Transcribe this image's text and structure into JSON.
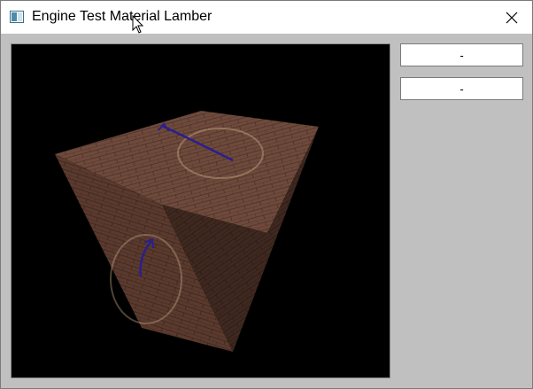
{
  "window": {
    "title": "Engine Test Material Lamber",
    "close_glyph": "✕"
  },
  "sidebar": {
    "buttons": [
      {
        "label": "-"
      },
      {
        "label": "-"
      }
    ]
  },
  "icons": {
    "app": "app-window-icon",
    "close": "close-icon",
    "cursor": "mouse-cursor-icon"
  },
  "colors": {
    "client_bg": "#c0c0c0",
    "viewport_bg": "#000000",
    "brick_top": "#6e4a3c",
    "brick_left": "#5b3a2e",
    "brick_right": "#3e281f",
    "arrow": "#2a1f8c"
  }
}
